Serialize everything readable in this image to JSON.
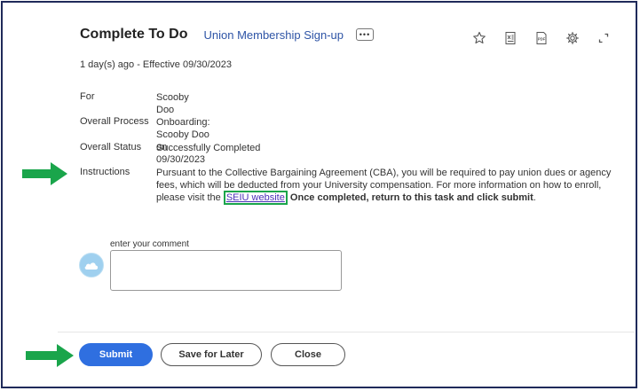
{
  "header": {
    "title": "Complete To Do",
    "subtitle": "Union Membership Sign-up",
    "more_label": "•••"
  },
  "meta": "1 day(s) ago - Effective 09/30/2023",
  "toolbar": [
    "star-icon",
    "excel-export-icon",
    "pdf-icon",
    "settings-icon",
    "expand-icon"
  ],
  "toolbar_pdf_text": "PDF",
  "fields": {
    "for": {
      "label": "For",
      "value": "Scooby Doo"
    },
    "process": {
      "label": "Overall Process",
      "value": "Onboarding: Scooby Doo on 09/30/2023"
    },
    "status": {
      "label": "Overall Status",
      "value": "Successfully Completed"
    },
    "instructions": {
      "label": "Instructions",
      "text_before": "Pursuant to the Collective Bargaining Agreement (CBA), you will be required to pay union dues or agency fees, which will be deducted from your University compensation. For more information on how to enroll, please visit the ",
      "link_text": "SEIU website",
      "bold_text": " Once completed, return to this task and click submit",
      "text_after": "."
    }
  },
  "comment": {
    "label": "enter your comment",
    "value": ""
  },
  "buttons": {
    "submit": "Submit",
    "save_for_later": "Save for Later",
    "close": "Close"
  },
  "colors": {
    "link": "#2e54a6",
    "primary": "#2f6fe0",
    "highlight": "#1aa54b",
    "frame": "#1f2a5a"
  }
}
